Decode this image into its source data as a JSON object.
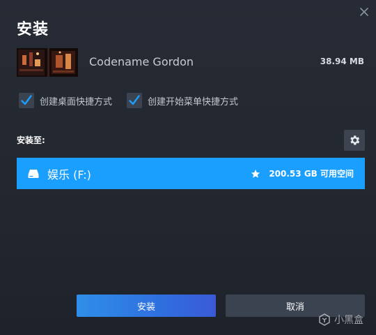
{
  "dialog": {
    "title": "安装",
    "close_icon": "close-icon"
  },
  "game": {
    "name": "Codename Gordon",
    "size": "38.94 MB"
  },
  "options": [
    {
      "label": "创建桌面快捷方式",
      "checked": true
    },
    {
      "label": "创建开始菜单快捷方式",
      "checked": true
    }
  ],
  "install_location": {
    "label": "安装至:",
    "settings_icon": "gear-icon",
    "drive": {
      "name": "娱乐 (F:)",
      "free_space": "200.53 GB 可用空间",
      "icon": "drive-icon",
      "favorite_icon": "star-icon"
    }
  },
  "buttons": {
    "install": "安装",
    "cancel": "取消"
  },
  "watermark": {
    "text": "小黑盒"
  },
  "colors": {
    "accent": "#1a9fff",
    "background": "#23272f",
    "button_secondary": "#3c4350"
  }
}
